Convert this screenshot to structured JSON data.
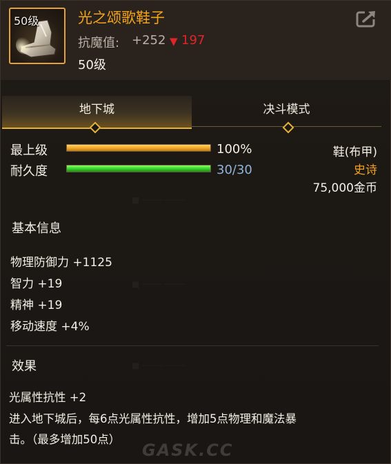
{
  "item": {
    "icon_level": "50级",
    "title": "光之颂歌鞋子",
    "resist_label": "抗魔值:",
    "resist_value": "+252",
    "resist_drop_arrow": "▼",
    "resist_drop": "197",
    "required_level": "50级"
  },
  "icons": {
    "item": "boot-icon",
    "share": "share-icon"
  },
  "tabs": [
    {
      "label": "地下城",
      "active": true
    },
    {
      "label": "决斗模式",
      "active": false
    }
  ],
  "bars": [
    {
      "label": "最上级",
      "value_text": "100%",
      "fraction": 1.0,
      "color": "#f3a623",
      "text_color": "#f4efe6"
    },
    {
      "label": "耐久度",
      "value_text": "30/30",
      "fraction": 1.0,
      "color": "#33d12a",
      "text_color": "#8fb4d8"
    }
  ],
  "side_info": {
    "type": "鞋(布甲)",
    "rarity": "史诗",
    "rarity_color": "#f2a31a",
    "price": "75,000金币"
  },
  "basic_info": {
    "title": "基本信息",
    "stats": [
      "物理防御力 +1125",
      "智力 +19",
      "精神 +19",
      "移动速度 +4%"
    ]
  },
  "effect": {
    "title": "效果",
    "line1": "光属性抗性 +2",
    "line2": "进入地下城后，每6点光属性抗性，增加5点物理和魔法暴",
    "line3": "击。（最多增加50点）"
  },
  "watermark": "GASK.CC"
}
